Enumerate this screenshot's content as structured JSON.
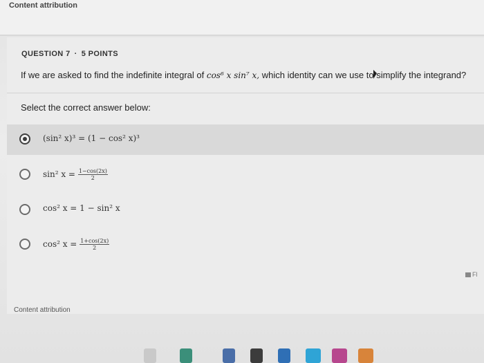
{
  "top": {
    "attribution": "Content attribution"
  },
  "question": {
    "number": "QUESTION 7",
    "separator": "·",
    "points": "5 POINTS",
    "prompt_before": "If we are asked to find the indefinite integral of",
    "prompt_math": "cos⁶ x sin⁷ x,",
    "prompt_after": "which identity can we use to simplify the integrand?",
    "instruction": "Select the correct answer below:"
  },
  "options": [
    {
      "label": "(sin² x)³ = (1 − cos² x)³",
      "selected": true
    },
    {
      "label_lhs": "sin² x =",
      "num": "1−cos(2x)",
      "den": "2",
      "selected": false
    },
    {
      "label": "cos² x = 1 − sin² x",
      "selected": false
    },
    {
      "label_lhs": "cos² x =",
      "num": "1+cos(2x)",
      "den": "2",
      "selected": false
    }
  ],
  "footer": {
    "attribution": "Content attribution"
  },
  "side_tab": {
    "label": "Fl",
    "icon": "flag-icon"
  },
  "colors": {
    "background": "#e8e8e8",
    "selected_row": "#d9d9d9",
    "radio": "#6b6b6b"
  }
}
